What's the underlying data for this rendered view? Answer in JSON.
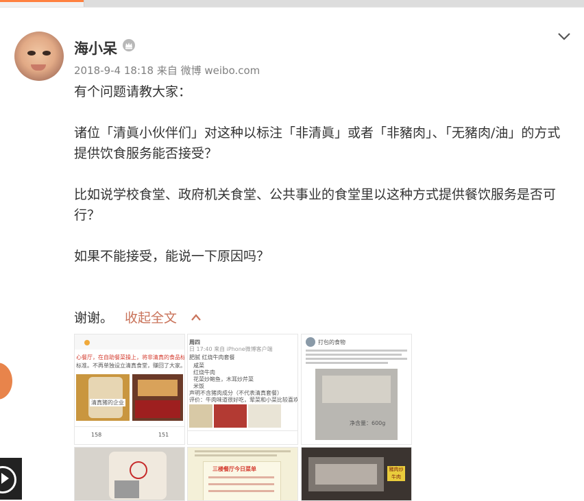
{
  "post": {
    "author": "海小呆",
    "meta": "2018-9-4 18:18 来自 微博 weibo.com",
    "paragraphs": [
      "有个问题请教大家：",
      "诸位「清眞小伙伴们」对这种以标注「非清眞」或者「非豬肉」、「无豬肉/油」的方式提供饮食服务能否接受？",
      "比如说学校食堂、政府机关食堂、公共事业的食堂里以这种方式提供餐饮服务是否可行？",
      "如果不能接受，能说一下原因吗？"
    ],
    "last_line": "谢谢。",
    "collapse_label": "收起全文"
  },
  "images": {
    "thumb1": {
      "text_line1": "心餐厅，在自助餐菜操上，将非清真的食品标出",
      "text_line2": "标准。不再单独设立清真食堂，赚回了大家。",
      "label": "清真猪的企业",
      "repost_count": "158",
      "comment_count": "151"
    },
    "thumb2": {
      "title": "周四",
      "sub": "日 17:40 来自 iPhone微博客户端",
      "items": [
        "肥腻 红烧牛肉套餐",
        "咸菜",
        "红烧牛肉",
        "花菜炒鲍鱼，木耳炒芹菜",
        "米饭"
      ],
      "note": "声明不含猪肉成分（不代表清真套餐）",
      "comment": "评价：牛肉味道很好吃，荤菜和小菜比较喜欢，刚吃中和了！"
    },
    "thumb3": {
      "header": "打包的食物",
      "pack_label": "净含量：600g"
    },
    "thumb5": {
      "menu_title": "三楼餐厅今日菜单"
    },
    "thumb6": {
      "label": "豬肉炒牛肉"
    }
  },
  "colors": {
    "link": "#c9735a",
    "meta": "#808080",
    "text": "#333333"
  },
  "icons": [
    "crown-icon",
    "chevron-down-icon",
    "chevron-up-icon",
    "play-icon"
  ]
}
